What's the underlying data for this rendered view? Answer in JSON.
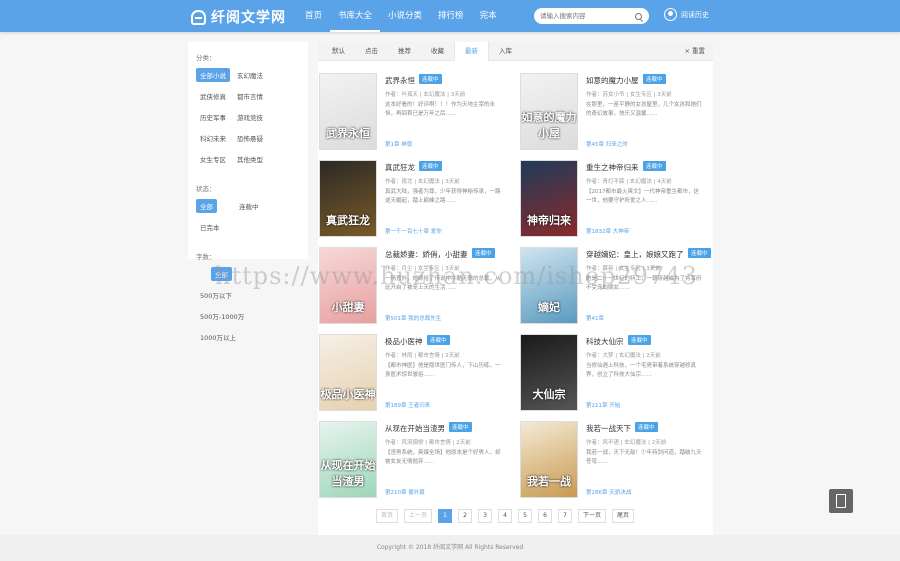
{
  "header": {
    "brand": "纤阅文学网",
    "nav": [
      "首页",
      "书库大全",
      "小说分类",
      "排行榜",
      "完本"
    ],
    "search_placeholder": "请输入搜索内容",
    "user": "阅读历史"
  },
  "sidebar": {
    "cat_title": "分类：",
    "cats": [
      "全部小说",
      "玄幻魔法",
      "武侠修真",
      "都市言情",
      "历史军事",
      "游戏竞技",
      "科幻未来",
      "恐怖悬疑",
      "女生专区",
      "其他类型"
    ],
    "status_title": "状态：",
    "statuses": [
      "全部",
      "连载中",
      "已完本"
    ],
    "words_title": "字数：",
    "words": [
      "全部",
      "500万以下",
      "500万-1000万",
      "1000万以上"
    ]
  },
  "sortbar": {
    "items": [
      "默认",
      "点击",
      "推荐",
      "收藏",
      "最新",
      "入库"
    ],
    "reset": "× 重置"
  },
  "books": [
    {
      "title": "武界永恒",
      "badge": "连载中",
      "meta": "作者：叶孤天 | 玄幻魔法 | 3天前",
      "desc": "这本好看的！好评啊！！！作为天地主宰的永恒，再回首已是万年之后……",
      "latest": "第1章 神尊",
      "cover_text": "武界永恒",
      "c1": "#f2f2f2",
      "c2": "#dcdcdc"
    },
    {
      "title": "如意的魔力小屋",
      "badge": "连载中",
      "meta": "作者：苏女小爷 | 女生专区 | 3天前",
      "desc": "在那里，一座平静的女孩屋里，几个女孩和她们的奇幻故事，快乐又温馨……",
      "latest": "第45章 归来之时",
      "cover_text": "如意的魔力小屋",
      "c1": "#f2f2f2",
      "c2": "#dcdcdc"
    },
    {
      "title": "真武狂龙",
      "badge": "连载中",
      "meta": "作者：夜北 | 玄幻魔法 | 3天前",
      "desc": "真武大陆，强者为尊，少年获得神秘传承，一路逆天崛起，踏上巅峰之路……",
      "latest": "第一千一百七十章 爱你",
      "cover_text": "真武狂龙",
      "c1": "#2c2a26",
      "c2": "#7a5a28"
    },
    {
      "title": "重生之神帝归来",
      "badge": "连载中",
      "meta": "作者：青灯不寐 | 玄幻魔法 | 4天前",
      "desc": "【2017都市最火爽文】一代神帝重生都市，这一世，他要守护所爱之人……",
      "latest": "第1832章 大神帝",
      "cover_text": "神帝归来",
      "c1": "#203a5a",
      "c2": "#8a2a2a"
    },
    {
      "title": "总裁娇妻：娇俏，小甜妻",
      "badge": "连载中",
      "meta": "作者：月尘 | 女生专区 | 3天前",
      "desc": "一场意外，她嫁给了传说中冷酷无情的总裁，从此开启了被宠上天的生活……",
      "latest": "第501章 我的总裁先生",
      "cover_text": "小甜妻",
      "c1": "#f7d8d8",
      "c2": "#e8a0a0"
    },
    {
      "title": "穿越嫡妃：皇上，娘娘又跑了",
      "badge": "连载中",
      "meta": "作者：慕容 | 女生专区 | 3天前",
      "desc": "她是二十一世纪的特工，一朝穿越成为了将军府不受宠的嫡女……",
      "latest": "第41章",
      "cover_text": "嫡妃",
      "c1": "#cfe4ef",
      "c2": "#5a9ac0"
    },
    {
      "title": "极品小医神",
      "badge": "连载中",
      "meta": "作者：林雨 | 都市言情 | 2天前",
      "desc": "【都市神医】他是隐世医门传人，下山历练，一身医术惊世骇俗……",
      "latest": "第189章 王者归来",
      "cover_text": "极品小医神",
      "c1": "#f6f0e6",
      "c2": "#e6d0b0"
    },
    {
      "title": "科技大仙宗",
      "badge": "连载中",
      "meta": "作者：大梦 | 玄幻魔法 | 2天前",
      "desc": "当修仙遇上科技，一个宅男带着系统穿越修真界，创立了科技大仙宗……",
      "latest": "第211章 开始",
      "cover_text": "大仙宗",
      "c1": "#1a1a1a",
      "c2": "#555555"
    },
    {
      "title": "从现在开始当渣男",
      "badge": "连载中",
      "meta": "作者：风流倜傥 | 都市言情 | 2天前",
      "desc": "【渣男系统，爽爆全场】他原本是个好男人，却被女友无情抛弃……",
      "latest": "第210章 番外篇",
      "cover_text": "从现在开始当渣男",
      "c1": "#e6f4ee",
      "c2": "#9ed6b8"
    },
    {
      "title": "我若一战天下",
      "badge": "连载中",
      "meta": "作者：风不语 | 玄幻魔法 | 2天前",
      "desc": "我若一战，天下无敌！少年持剑问道，踏破九天苍穹……",
      "latest": "第286章 天骄决战",
      "cover_text": "我若一战",
      "c1": "#f4ead6",
      "c2": "#c89a50"
    }
  ],
  "pager": [
    "首页",
    "上一页",
    "1",
    "2",
    "3",
    "4",
    "5",
    "6",
    "7",
    "下一页",
    "尾页"
  ],
  "footer": "Copyright © 2018 纤阅文学网 All Rights Reserved",
  "watermark": "https://www.huzhan.com/ishop29743"
}
